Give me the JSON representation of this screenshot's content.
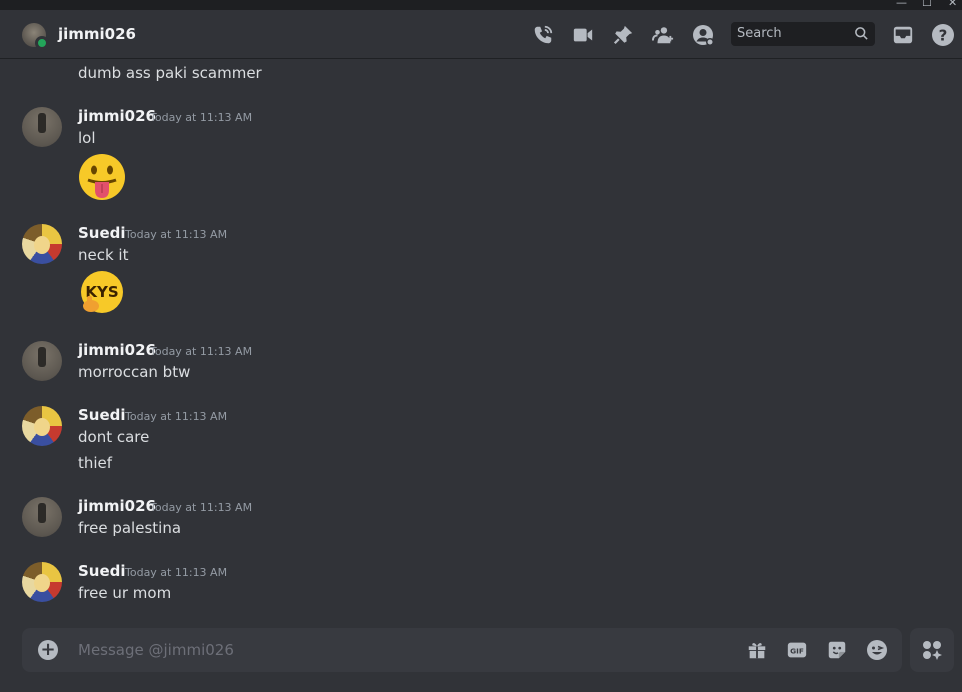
{
  "window": {
    "minimize_glyph": "—",
    "maximize_glyph": "☐",
    "close_glyph": "✕"
  },
  "header": {
    "username": "jimmi026",
    "search_placeholder": "Search",
    "icons": [
      "call-icon",
      "video-icon",
      "pin-icon",
      "add-friend-icon",
      "profile-icon",
      "search-icon",
      "inbox-icon",
      "help-icon"
    ]
  },
  "messages": [
    {
      "type": "continuation",
      "text": "dumb ass paki scammer"
    },
    {
      "author": "jimmi026",
      "time": "Today at 11:13 AM",
      "text": "lol",
      "emoji": "tongue-face"
    },
    {
      "author": "Suedi",
      "time": "Today at 11:13 AM",
      "text": "neck it",
      "emoji": "kys-sticker",
      "emoji_text": "KYS"
    },
    {
      "author": "jimmi026",
      "time": "Today at 11:13 AM",
      "text": "morroccan btw"
    },
    {
      "author": "Suedi",
      "time": "Today at 11:13 AM",
      "text": "dont care",
      "text2": "thief"
    },
    {
      "author": "jimmi026",
      "time": "Today at 11:13 AM",
      "text": "free palestina"
    },
    {
      "author": "Suedi",
      "time": "Today at 11:13 AM",
      "text": "free ur mom"
    }
  ],
  "composer": {
    "placeholder": "Message @jimmi026",
    "gif_label": "GIF",
    "icons": [
      "add-attachment-icon",
      "gift-icon",
      "gif-icon",
      "sticker-icon",
      "emoji-icon",
      "apps-icon"
    ]
  },
  "colors": {
    "background": "#313338",
    "composer": "#383a40",
    "online": "#23a55a",
    "timestamp": "#949ba4"
  }
}
